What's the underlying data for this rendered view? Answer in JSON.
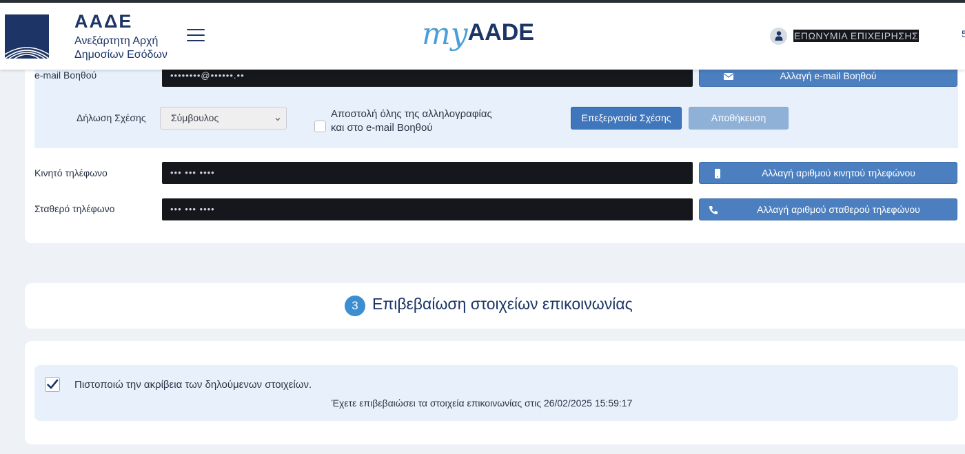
{
  "header": {
    "logo_name": "ΑΑΔΕ",
    "logo_sub_line1": "Ανεξάρτητη Αρχή",
    "logo_sub_line2": "Δημοσίων Εσόδων",
    "brand_my": "my",
    "brand_aade": "AADE",
    "user_name": "ΕΠΩΝΥΜΙΑ ΕΠΙΧΕΙΡΗΣΗΣ",
    "overflow_char": "5",
    "icons": [
      "logo-icon",
      "hamburger-menu-icon",
      "user-icon"
    ]
  },
  "contact": {
    "assistant_email_label": "e-mail Βοηθού",
    "assistant_email_value": "••••••••@••••••.••",
    "change_assistant_email_button": "Αλλαγή e-mail Βοηθού",
    "relation_label": "Δήλωση Σχέσης",
    "relation_selected": "Σύμβουλος",
    "send_all_mail_line1": "Αποστολή όλης της αλληλογραφίας",
    "send_all_mail_line2": "και στο e-mail Βοηθού",
    "send_all_mail_checked": false,
    "edit_relation_button": "Επεξεργασία Σχέσης",
    "save_button": "Αποθήκευση",
    "mobile_label": "Κινητό τηλέφωνο",
    "mobile_value": "••• ••• ••••",
    "change_mobile_button": "Αλλαγή αριθμού κινητού τηλεφώνου",
    "landline_label": "Σταθερό τηλέφωνο",
    "landline_value": "••• ••• ••••",
    "change_landline_button": "Αλλαγή αριθμού σταθερού τηλεφώνου",
    "icons": [
      "envelope-icon",
      "mobile-phone-icon",
      "phone-icon"
    ]
  },
  "step3": {
    "number": "3",
    "title": "Επιβεβαίωση στοιχείων επικοινωνίας"
  },
  "confirmation": {
    "checked": true,
    "text": "Πιστοποιώ την ακρίβεια των δηλούμενων στοιχείων.",
    "confirmed_message": "Έχετε επιβεβαιώσει τα στοιχεία επικοινωνίας στις 26/02/2025 15:59:17"
  },
  "colors": {
    "brand_dark": "#1c3566",
    "brand_light": "#4a9fd8",
    "primary_button": "#4b7fbf",
    "disabled_button": "#8fb1d8",
    "panel_tint": "#e8f1fb",
    "page_bg": "#eef1f5"
  }
}
